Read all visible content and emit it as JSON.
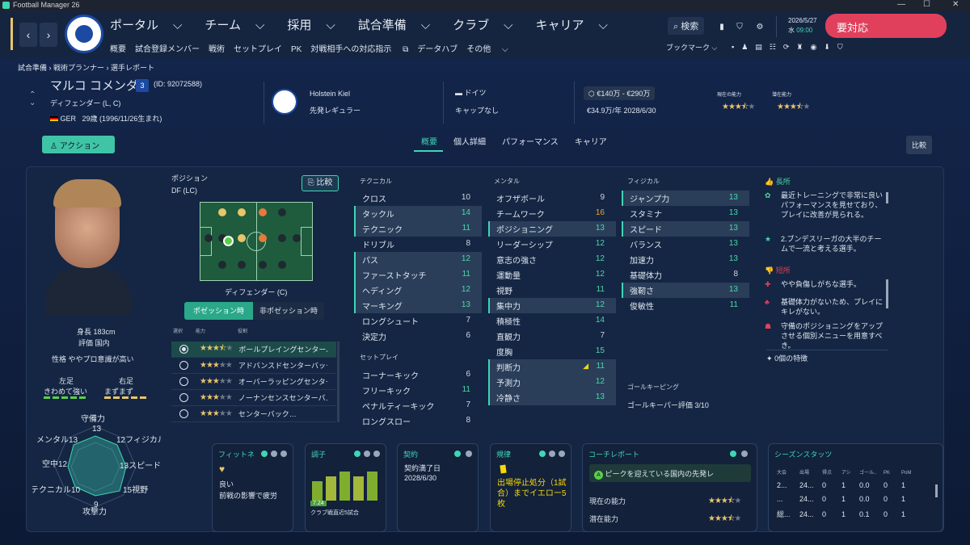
{
  "window": {
    "title": "Football Manager 26",
    "min": "—",
    "max": "☐",
    "close": "✕"
  },
  "nav": {
    "main": [
      "ポータル",
      "チーム",
      "採用",
      "試合準備",
      "クラブ",
      "キャリア"
    ],
    "active": "試合準備",
    "sub": [
      "概要",
      "試合登録メンバー",
      "戦術",
      "セットプレイ",
      "PK",
      "対戦相手への対応指示",
      "データハブ",
      "その他"
    ],
    "search": "検索",
    "date": "2026/5/27",
    "day": "水",
    "time": "09:00",
    "alert": "要対応",
    "bookmark": "ブックマーク"
  },
  "breadcrumb": [
    "試合準備",
    "戦術プランナー",
    "選手レポート"
  ],
  "player": {
    "name": "マルコ コメンダ",
    "number": "3",
    "id": "(ID: 92072588)",
    "position": "ディフェンダー (L, C)",
    "nation": "GER",
    "age": "29歳 (1996/11/26生まれ)",
    "club": "Holstein Kiel",
    "status": "先発レギュラー",
    "country": "ドイツ",
    "caps": "キャップなし",
    "value": "€140万 - €290万",
    "wage": "€34.9万/年 2028/6/30",
    "ca_label": "現在の能力",
    "pa_label": "潜在能力",
    "height": "身長 183cm",
    "rep": "評価 国内",
    "personality": "性格 ややプロ意識が高い",
    "left_foot": "左足",
    "left_foot_val": "きわめて強い",
    "right_foot": "右足",
    "right_foot_val": "まずまず"
  },
  "action_btn": "アクション",
  "compare": "比較",
  "tabs": [
    "概要",
    "個人詳細",
    "パフォーマンス",
    "キャリア"
  ],
  "positions": {
    "title": "ポジション",
    "pos": "DF (LC)",
    "compare": "比較",
    "label": "ディフェンダー (C)",
    "in_poss": "ポゼッション時",
    "out_poss": "非ポゼッション時",
    "hdr": [
      "選択",
      "能力",
      "役割"
    ],
    "roles": [
      {
        "name": "ボールプレイングセンターバ",
        "stars": 3.5
      },
      {
        "name": "アドバンスドセンターバック",
        "stars": 3
      },
      {
        "name": "オーバーラッピングセンターバ",
        "stars": 3
      },
      {
        "name": "ノーナンセンスセンターバ",
        "stars": 3
      },
      {
        "name": "センターバック",
        "stars": 3
      }
    ]
  },
  "technical": {
    "title": "テクニカル",
    "rows": [
      [
        "クロス",
        "10"
      ],
      [
        "タックル",
        "14"
      ],
      [
        "テクニック",
        "11"
      ],
      [
        "ドリブル",
        "8"
      ],
      [
        "パス",
        "12"
      ],
      [
        "ファーストタッチ",
        "11"
      ],
      [
        "ヘディング",
        "12"
      ],
      [
        "マーキング",
        "13"
      ],
      [
        "ロングシュート",
        "7"
      ],
      [
        "決定力",
        "6"
      ]
    ]
  },
  "setpiece": {
    "title": "セットプレイ",
    "rows": [
      [
        "コーナーキック",
        "6"
      ],
      [
        "フリーキック",
        "11"
      ],
      [
        "ペナルティーキック",
        "7"
      ],
      [
        "ロングスロー",
        "8"
      ]
    ]
  },
  "mental": {
    "title": "メンタル",
    "rows": [
      [
        "オフザボール",
        "9"
      ],
      [
        "チームワーク",
        "16"
      ],
      [
        "ポジショニング",
        "13"
      ],
      [
        "リーダーシップ",
        "12"
      ],
      [
        "意志の強さ",
        "12"
      ],
      [
        "運動量",
        "12"
      ],
      [
        "視野",
        "11"
      ],
      [
        "集中力",
        "12"
      ],
      [
        "積極性",
        "14"
      ],
      [
        "直観力",
        "7"
      ],
      [
        "度胸",
        "15"
      ],
      [
        "判断力",
        "11"
      ],
      [
        "予測力",
        "12"
      ],
      [
        "冷静さ",
        "13"
      ]
    ]
  },
  "physical": {
    "title": "フィジカル",
    "rows": [
      [
        "ジャンプ力",
        "13"
      ],
      [
        "スタミナ",
        "13"
      ],
      [
        "スピード",
        "13"
      ],
      [
        "バランス",
        "13"
      ],
      [
        "加速力",
        "13"
      ],
      [
        "基礎体力",
        "8"
      ],
      [
        "強靭さ",
        "13"
      ],
      [
        "俊敏性",
        "11"
      ]
    ]
  },
  "gk": {
    "title": "ゴールキーピング",
    "rating": "ゴールキーパー評価 3/10"
  },
  "strengths": {
    "title": "長所",
    "items": [
      "最近トレーニングで非常に良いパフォーマンスを見せており、プレイに改善が見られる。",
      "2.ブンデスリーガの大半のチームで一流と考える選手。"
    ]
  },
  "weaknesses": {
    "title": "短所",
    "items": [
      "やや負傷しがちな選手。",
      "基礎体力がないため、プレイにキレがない。",
      "守備のポジショニングをアップさせる個別メニューを用意すべき。"
    ]
  },
  "traits": "0個の特徴",
  "radar": {
    "labels": [
      "守備力",
      "フィジカル",
      "スピード",
      "視野",
      "攻撃力",
      "テクニカル",
      "空中",
      "メンタル"
    ],
    "values": [
      13,
      12,
      13,
      15,
      9,
      10,
      12,
      13
    ]
  },
  "fitness": {
    "title": "フィットネ",
    "state": "良い",
    "note": "前戦の影響で疲労"
  },
  "form": {
    "title": "調子",
    "rating": "7.24",
    "note": "クラブ戦直近5試合",
    "bars": [
      6.8,
      7.0,
      7.2,
      7.0,
      7.2
    ]
  },
  "contract": {
    "title": "契約",
    "label": "契約満了日",
    "date": "2028/6/30"
  },
  "discipline": {
    "title": "規律",
    "text": "出場停止処分（1試合）までイエロー5枚"
  },
  "coach": {
    "title": "コーチレポート",
    "summary": "ピークを迎えている国内の先発レ",
    "ca": "現在の能力",
    "pa": "潜在能力"
  },
  "season": {
    "title": "シーズンスタッツ",
    "hdr": [
      "大会",
      "出場",
      "得点",
      "アシ",
      "ゴール..",
      "PK",
      "PoM"
    ],
    "rows": [
      [
        "2...",
        "24...",
        "0",
        "1",
        "0.0",
        "0",
        "1"
      ],
      [
        "...",
        "24...",
        "0",
        "1",
        "0.0",
        "0",
        "1"
      ],
      [
        "総...",
        "24...",
        "0",
        "1",
        "0.1",
        "0",
        "1"
      ]
    ]
  },
  "colors": {
    "accent": "#3fd6b6",
    "alert": "#e1405c",
    "active_nav": "#ee5b7a"
  }
}
